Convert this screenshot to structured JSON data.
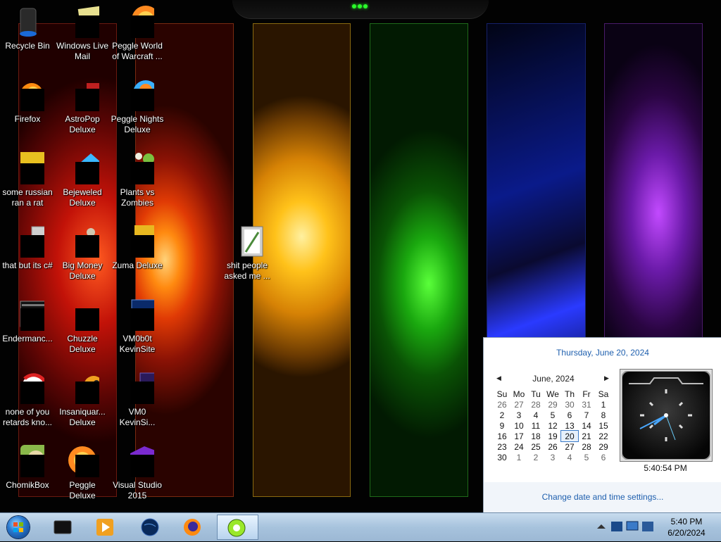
{
  "desktop": {
    "icons": [
      {
        "label": "Recycle Bin",
        "icon": "recycle-bin-icon"
      },
      {
        "label": "Windows Live Mail",
        "icon": "windows-live-mail-icon"
      },
      {
        "label": "Peggle World of Warcraft ...",
        "icon": "peggle-icon"
      },
      {
        "label": "Firefox",
        "icon": "firefox-icon"
      },
      {
        "label": "AstroPop Deluxe",
        "icon": "astropop-icon"
      },
      {
        "label": "Peggle Nights Deluxe",
        "icon": "peggle-nights-icon"
      },
      {
        "label": "some russian ran a rat",
        "icon": "file-icon"
      },
      {
        "label": "Bejeweled Deluxe",
        "icon": "bejeweled-icon"
      },
      {
        "label": "Plants vs Zombies",
        "icon": "plants-vs-zombies-icon"
      },
      {
        "label": "that but its c#",
        "icon": "file-icon"
      },
      {
        "label": "Big Money Deluxe",
        "icon": "big-money-icon"
      },
      {
        "label": "Zuma Deluxe",
        "icon": "zuma-icon"
      },
      {
        "label": "Endermanc...",
        "icon": "console-icon"
      },
      {
        "label": "Chuzzle Deluxe",
        "icon": "chuzzle-icon"
      },
      {
        "label": "VM0b0t KevinSite",
        "icon": "shortcut-icon"
      },
      {
        "label": "none of you retards kno...",
        "icon": "file-icon"
      },
      {
        "label": "Insaniquar... Deluxe",
        "icon": "insaniquarium-icon"
      },
      {
        "label": "VM0 KevinSi...",
        "icon": "shortcut-icon"
      },
      {
        "label": "ChomikBox",
        "icon": "chomikbox-icon"
      },
      {
        "label": "Peggle Deluxe",
        "icon": "peggle-deluxe-icon"
      },
      {
        "label": "Visual Studio 2015",
        "icon": "visual-studio-icon"
      },
      {
        "label": "shit people asked me ...",
        "icon": "folder-icon"
      }
    ]
  },
  "taskbar": {
    "apps": [
      {
        "name": "media-center",
        "icon": "media-center-icon"
      },
      {
        "name": "windows-media-player",
        "icon": "media-player-icon"
      },
      {
        "name": "globe-app",
        "icon": "globe-icon"
      },
      {
        "name": "firefox",
        "icon": "firefox-icon"
      },
      {
        "name": "active-app",
        "icon": "green-orb-icon"
      }
    ],
    "clock_time": "5:40 PM",
    "clock_date": "6/20/2024"
  },
  "calendar": {
    "header": "Thursday, June 20, 2024",
    "month_label": "June, 2024",
    "weekdays": [
      "Su",
      "Mo",
      "Tu",
      "We",
      "Th",
      "Fr",
      "Sa"
    ],
    "weeks": [
      [
        "26",
        "27",
        "28",
        "29",
        "30",
        "31",
        "1"
      ],
      [
        "2",
        "3",
        "4",
        "5",
        "6",
        "7",
        "8"
      ],
      [
        "9",
        "10",
        "11",
        "12",
        "13",
        "14",
        "15"
      ],
      [
        "16",
        "17",
        "18",
        "19",
        "20",
        "21",
        "22"
      ],
      [
        "23",
        "24",
        "25",
        "26",
        "27",
        "28",
        "29"
      ],
      [
        "30",
        "1",
        "2",
        "3",
        "4",
        "5",
        "6"
      ]
    ],
    "today": "20",
    "clock_display": "5:40:54 PM",
    "settings_link": "Change date and time settings..."
  }
}
